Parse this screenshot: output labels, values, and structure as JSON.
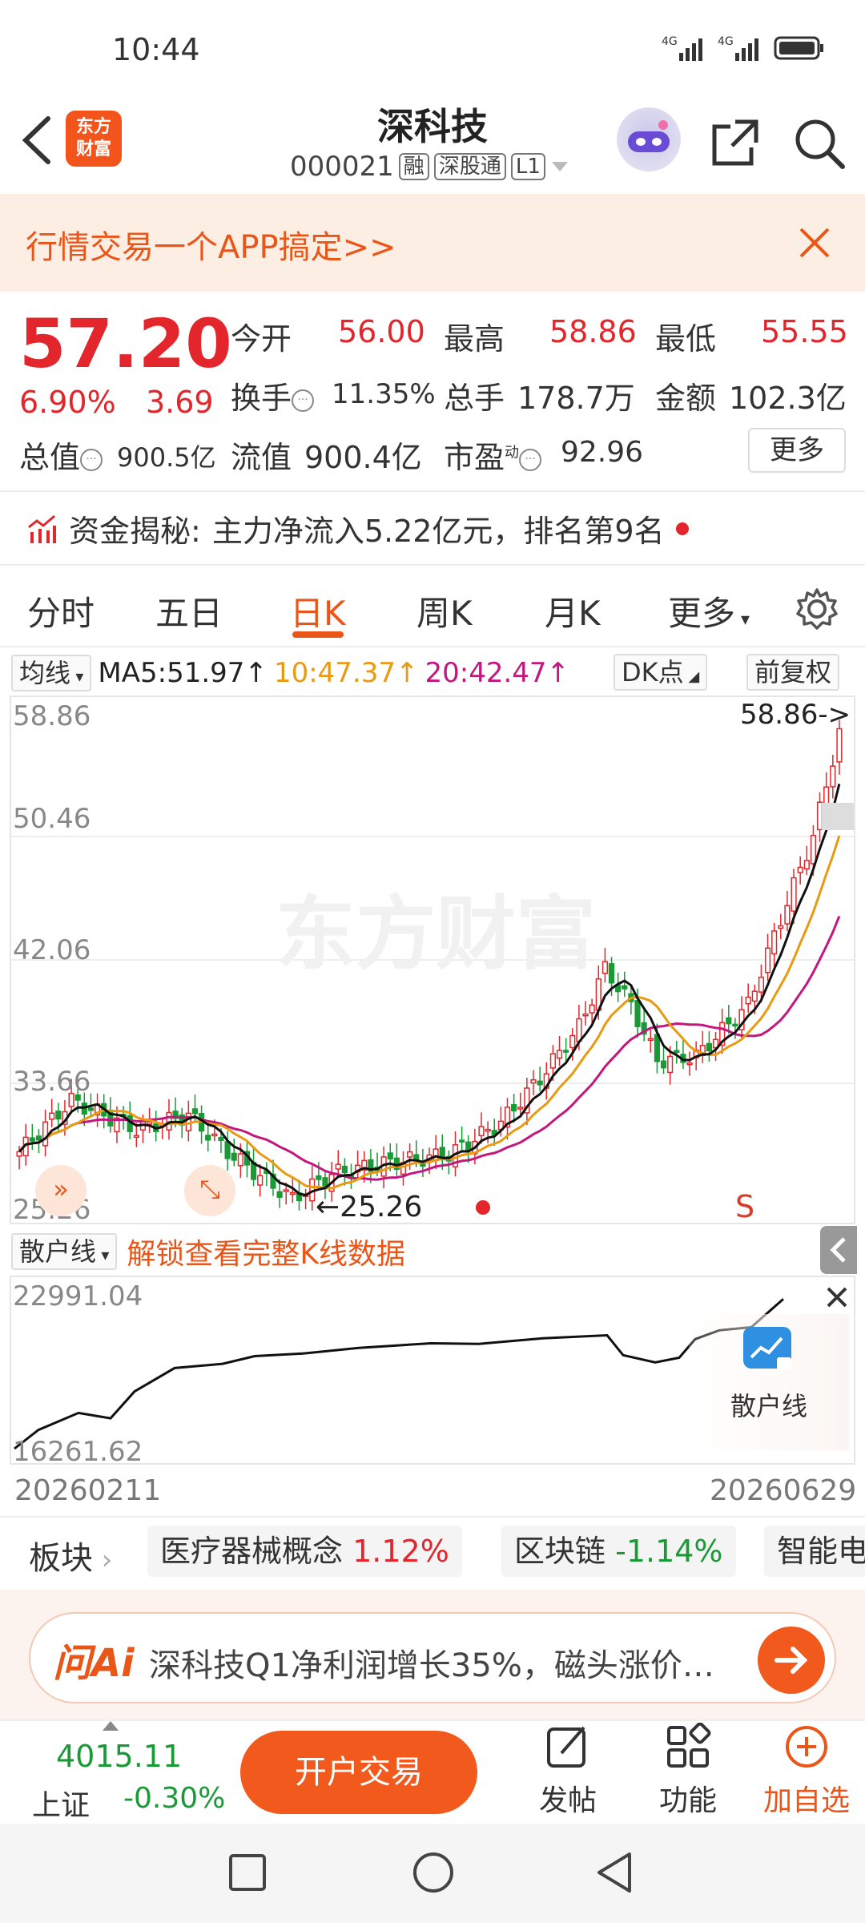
{
  "status": {
    "time": "10:44",
    "net1": "4G",
    "net2": "4G"
  },
  "header": {
    "logo_line1": "东方",
    "logo_line2": "财富",
    "title": "深科技",
    "code": "000021",
    "tag1": "融",
    "tag2": "深股通",
    "tag3": "L1"
  },
  "banner": {
    "text": "行情交易一个APP搞定>>"
  },
  "quote": {
    "price": "57.20",
    "pct": "6.90%",
    "change": "3.69",
    "open_label": "今开",
    "open": "56.00",
    "high_label": "最高",
    "high": "58.86",
    "low_label": "最低",
    "low": "55.55",
    "turnover_label": "换手",
    "turnover": "11.35%",
    "volume_label": "总手",
    "volume": "178.7万",
    "amount_label": "金额",
    "amount": "102.3亿",
    "mktcap_label": "总值",
    "mktcap": "900.5亿",
    "float_label": "流值",
    "float": "900.4亿",
    "pe_label": "市盈",
    "pe_sup": "动",
    "pe": "92.96",
    "more": "更多"
  },
  "fund": {
    "label": "资金揭秘:",
    "text": "主力净流入5.22亿元，排名第9名"
  },
  "tabs": [
    "分时",
    "五日",
    "日K",
    "周K",
    "月K",
    "更多"
  ],
  "ma": {
    "selector": "均线",
    "ma5": "MA5:51.97↑",
    "ma10": "10:47.37↑",
    "ma20": "20:42.47↑",
    "dk": "DK点",
    "adjust": "前复权"
  },
  "kline": {
    "y_labels": [
      "58.86",
      "50.46",
      "42.06",
      "33.66",
      "25.26"
    ],
    "max_label": "58.86->",
    "min_label": "25.26",
    "watermark": "东方财富",
    "signal": "S"
  },
  "retail": {
    "selector": "散户线",
    "unlock": "解锁查看完整K线数据",
    "top": "22991.04",
    "bottom": "16261.62",
    "box_label": "散户线",
    "date_start": "20260211",
    "date_end": "20260629"
  },
  "sector": {
    "label": "板块",
    "items": [
      {
        "name": "医疗器械概念",
        "pct": "1.12%"
      },
      {
        "name": "区块链",
        "pct": "-1.14%"
      },
      {
        "name": "智能电",
        "pct": ""
      }
    ]
  },
  "ai": {
    "logo": "问Ai",
    "text": "深科技Q1净利润增长35%，磁头涨价…"
  },
  "bottom": {
    "index_value": "4015.11",
    "index_name": "上证",
    "index_change": "-0.30%",
    "open_account": "开户交易",
    "post": "发帖",
    "function": "功能",
    "add_watch": "加自选"
  },
  "colors": {
    "accent": "#ea5618",
    "up": "#e3262b",
    "down": "#1a9a36"
  }
}
